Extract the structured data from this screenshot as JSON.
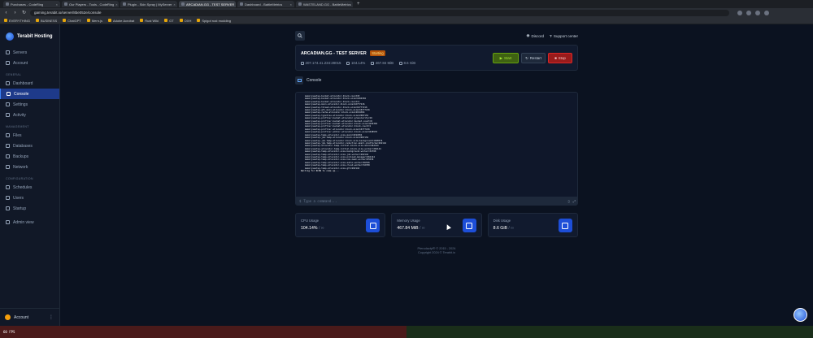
{
  "browser": {
    "tabs": [
      {
        "label": "Purchases - CodeRing"
      },
      {
        "label": "Our Players - Tools - CodeRing"
      },
      {
        "label": "Plugin - Skin Spray | MyServer"
      },
      {
        "label": "ARCADIAN.GG - TEST SERVER",
        "active": true
      },
      {
        "label": "Dashboard - BattleMetrics"
      },
      {
        "label": "WASTELAND.GG - BattleMetrics"
      }
    ],
    "url": "gaming.terabit.io/server/8be052e/console",
    "bookmarks": [
      "EVERYTHING",
      "BUSINESS",
      "ChatGPT",
      "Mern.js",
      "Adobe Acrobat",
      "Rust Wiki",
      "GT",
      "OXH",
      "Spigot rust modding"
    ]
  },
  "sidebar": {
    "brand": "Terabit Hosting",
    "top_items": [
      {
        "label": "Servers",
        "icon": "server-icon"
      },
      {
        "label": "Account",
        "icon": "user-icon"
      }
    ],
    "sections": [
      {
        "title": "General",
        "items": [
          {
            "label": "Dashboard",
            "icon": "dashboard-icon"
          },
          {
            "label": "Console",
            "icon": "terminal-icon",
            "active": true
          },
          {
            "label": "Settings",
            "icon": "gear-icon"
          },
          {
            "label": "Activity",
            "icon": "activity-icon"
          }
        ]
      },
      {
        "title": "Management",
        "items": [
          {
            "label": "Files",
            "icon": "folder-icon"
          },
          {
            "label": "Databases",
            "icon": "database-icon"
          },
          {
            "label": "Backups",
            "icon": "archive-icon"
          },
          {
            "label": "Network",
            "icon": "network-icon"
          }
        ]
      },
      {
        "title": "Configuration",
        "items": [
          {
            "label": "Schedules",
            "icon": "calendar-icon"
          },
          {
            "label": "Users",
            "icon": "users-icon"
          },
          {
            "label": "Startup",
            "icon": "play-icon"
          }
        ]
      }
    ],
    "admin": "Admin view",
    "account": "Account"
  },
  "topbar": {
    "discord": "Discord",
    "support": "Support center"
  },
  "server": {
    "name": "ARCADIAN.GG - TEST SERVER",
    "status": "Starting",
    "ip": "207.174.41.234:28015",
    "cpu": "104.14%",
    "memory": "467.84 MiB",
    "disk": "8.6 GiB",
    "start": "Start",
    "restart": "Restart",
    "stop": "Stop"
  },
  "console": {
    "title": "Console",
    "lines": [
      "memoryssetup-bucket-allocator-block-count=8",
      "memoryssetup-bucket-allocator-block-size=4194304",
      "memoryssetup-bucket-allocator-block-count=1",
      "memoryssetup-main-allocator-block-size=16777216",
      "memoryssetup-thread-allocator-block-size=16777216",
      "memoryssetup-gfx-main-allocator-block-size=16777216",
      "memoryssetup-cache-allocator-block-size=4194304",
      "memoryssetup-typetree-allocator-block-size=2097152",
      "memoryssetup-profiler-bucket-allocator-granularity=16",
      "memoryssetup-profiler-bucket-allocator-bucket-count=8",
      "memoryssetup-profiler-bucket-allocator-block-size=4194304",
      "memoryssetup-profiler-bucket-allocator-block-count=1",
      "memoryssetup-profiler-allocator-block-size=16777216",
      "memoryssetup-profiler-editor-allocator-block-size=1048576",
      "memoryssetup-temp-allocator-size-main=4194304",
      "memoryssetup-job-temp-allocator-block-size=2097152",
      "memoryssetup-job-temp-allocator-block-size-background=1048576",
      "memoryssetup-job-temp-allocator-reduction-small-platforms=262144",
      "memoryssetup-allocator-temp-initial-block-size-main=262144",
      "memoryssetup-allocator-temp-initial-block-size-worker=262144",
      "memoryssetup-temp-allocator-size-background-worker=32768",
      "memoryssetup-temp-allocator-size-job-worker=262144",
      "memoryssetup-temp-allocator-size-preload-manager=262144",
      "memoryssetup-temp-allocator-size-nav-mesh-worker=65536",
      "memoryssetup-temp-allocator-size-audio-worker=65536",
      "memoryssetup-temp-allocator-size-cloud-worker=32768",
      "memoryssetup-temp-allocator-size-gfx=262144",
      "Waiting for RCON to come up..."
    ],
    "placeholder": "Type a command...",
    "prompt": "$"
  },
  "stats": [
    {
      "label": "CPU Usage",
      "value": "104.14%",
      "limit": "/ ∞",
      "icon": "cpu-icon"
    },
    {
      "label": "Memory Usage",
      "value": "467.84 MiB",
      "limit": "/ ∞",
      "icon": "memory-icon"
    },
    {
      "label": "Disk Usage",
      "value": "8.6 GiB",
      "limit": "/ ∞",
      "icon": "save-icon"
    }
  ],
  "footer": {
    "line1": "Pterodactyl® © 2015 - 2024",
    "line2": "Copyright 2024 © Terabit.io"
  },
  "taskbar": {
    "fps": "60 FPS"
  }
}
